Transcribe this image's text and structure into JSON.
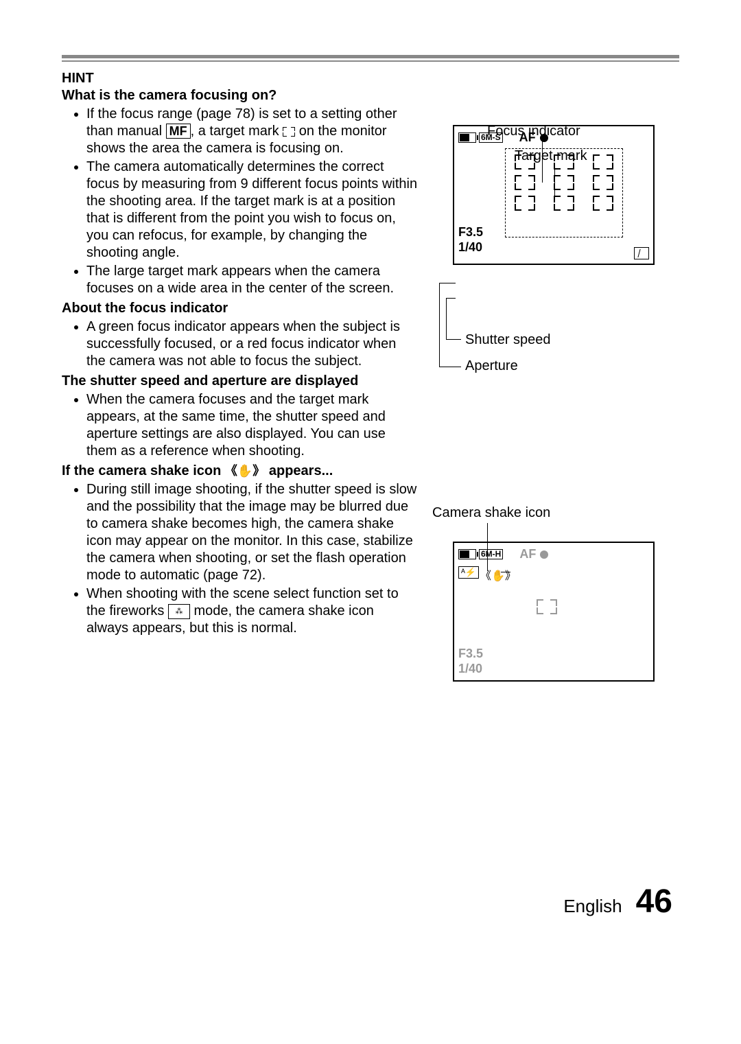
{
  "hint_title": "HINT",
  "q1": "What is the camera focusing on?",
  "q1_bullets": {
    "b1_part1": "If the focus range (page 78) is set to a setting other than manual ",
    "b1_mf": "MF",
    "b1_part2": ", a target mark ",
    "b1_part3": " on the monitor shows the area the camera is focusing on.",
    "b2": "The camera automatically determines the correct focus by measuring from 9 different focus points within the shooting area. If the target mark is at a position that is different from the point you wish to focus on, you can refocus, for example, by changing the shooting angle.",
    "b3": "The large target mark appears when the camera focuses on a wide area in the center of the screen."
  },
  "q2": "About the focus indicator",
  "q2_bullets": {
    "b1": "A green focus indicator appears when the subject is successfully focused, or a red focus indicator when the camera was not able to focus the subject."
  },
  "q3": "The shutter speed and aperture are displayed",
  "q3_bullets": {
    "b1": "When the camera focuses and the target mark appears, at the same time, the shutter speed and aperture settings are also displayed. You can use them as a reference when shooting."
  },
  "q4_part1": "If the camera shake icon ",
  "q4_part2": " appears...",
  "q4_bullets": {
    "b1": "During still image shooting, if the shutter speed is slow and the possibility that the image may be blurred due to camera shake becomes high, the camera shake icon may appear on the monitor. In this case, stabilize the camera when shooting, or set the flash operation mode to automatic (page 72).",
    "b2_part1": "When shooting with the scene select function set to the fireworks ",
    "b2_part2": " mode, the camera shake icon always appears, but this is normal."
  },
  "diagram1": {
    "focus_indicator": "Focus indicator",
    "target_mark": "Target mark",
    "af": "AF",
    "res": "6M-S",
    "aperture": "F3.5",
    "shutter": "1/40",
    "shutter_label": "Shutter speed",
    "aperture_label": "Aperture"
  },
  "diagram2": {
    "shake_label": "Camera shake icon",
    "res": "6M-H",
    "af": "AF",
    "flash": "ᴬ⚡",
    "shake": "《✋》",
    "aperture": "F3.5",
    "shutter": "1/40"
  },
  "footer": {
    "lang": "English",
    "page": "46"
  }
}
